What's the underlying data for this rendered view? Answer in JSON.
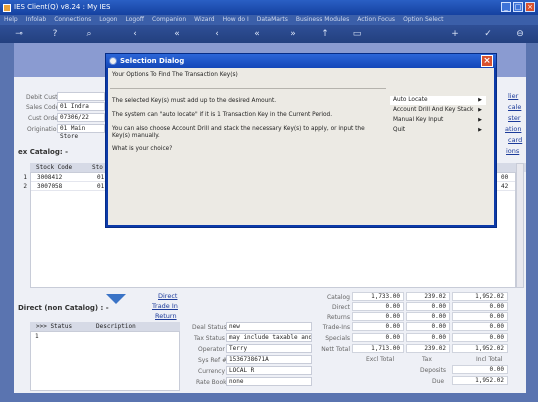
{
  "window": {
    "title": "IES Client(Q) v8.24 : My IES"
  },
  "menu": [
    "Help",
    "Infolab",
    "Connections",
    "Logon",
    "Logoff",
    "Companion",
    "Wizard",
    "How do I",
    "DataMarts",
    "Business Modules",
    "Action Focus",
    "Option Select"
  ],
  "header_form": {
    "debit_cust_label": "Debit Cust?",
    "sales_code_label": "Sales Code",
    "sales_code": "01 Indra",
    "cust_order_label": "Cust Order",
    "cust_order": "07306/22",
    "origination_label": "Origination",
    "origination": "01 Main Store"
  },
  "right_links": [
    "lier",
    "cale",
    "ster",
    "ation",
    "card",
    "ions"
  ],
  "catalog": {
    "title": "ex Catalog: -",
    "col_stock": "Stock Code",
    "col_store": "Sto",
    "rows": [
      {
        "num": "1",
        "stock": "3008412",
        "store": "01",
        "right": "00"
      },
      {
        "num": "2",
        "stock": "3007058",
        "store": "01",
        "right": "42"
      }
    ]
  },
  "direct": {
    "title": "Direct (non Catalog) : -",
    "links": [
      "Direct",
      "Trade In",
      "Return"
    ],
    "col_status": ">>> Status",
    "col_desc": "Description",
    "row_num": "1"
  },
  "deal": {
    "deal_status_label": "Deal Status",
    "deal_status": "new",
    "tax_status_label": "Tax Status",
    "tax_status": "may include taxable and",
    "operator_label": "Operator",
    "operator": "Terry",
    "sys_ref_label": "Sys Ref #",
    "sys_ref": "1536738671A",
    "currency_label": "Currency",
    "currency": "LOCAL R",
    "rate_book_label": "Rate Book",
    "rate_book": "none"
  },
  "totals": {
    "rows": [
      {
        "label": "Catalog",
        "excl": "1,733.00",
        "tax": "239.02",
        "incl": "1,952.02"
      },
      {
        "label": "Direct",
        "excl": "0.00",
        "tax": "0.00",
        "incl": "0.00"
      },
      {
        "label": "Returns",
        "excl": "0.00",
        "tax": "0.00",
        "incl": "0.00"
      },
      {
        "label": "Trade-Ins",
        "excl": "0.00",
        "tax": "0.00",
        "incl": "0.00"
      },
      {
        "label": "Specials",
        "excl": "0.00",
        "tax": "0.00",
        "incl": "0.00"
      },
      {
        "label": "Nett Total",
        "excl": "1,713.00",
        "tax": "239.02",
        "incl": "1,952.02"
      }
    ],
    "excl_label": "Excl Total",
    "tax_label": "Tax",
    "incl_label": "Incl Total",
    "deposits_label": "Deposits",
    "deposits": "0.00",
    "due_label": "Due",
    "due": "1,952.02"
  },
  "dialog": {
    "title": "Selection Dialog",
    "heading": "Your Options To Find The Transaction Key(s)",
    "line1": "The selected Key(s) must add up to the desired Amount.",
    "line2": "The system can \"auto locate\" if it is 1 Transaction Key in the Current Period.",
    "line3": "You can also choose Account Drill and stack the necessary Key(s) to apply, or input the Key(s) manually.",
    "line4": "What is your choice?",
    "options": [
      "Auto Locate",
      "Account Drill And Key Stack",
      "Manual Key Input",
      "Quit"
    ]
  }
}
